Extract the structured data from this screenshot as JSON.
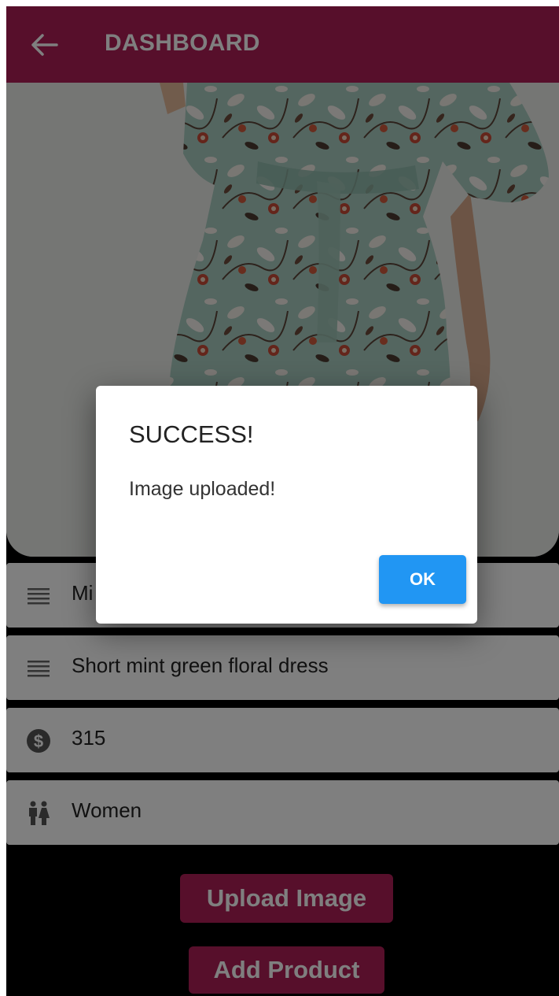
{
  "app_bar": {
    "title": "DASHBOARD",
    "back_icon": "arrow-left-icon",
    "color": "#ae1f56"
  },
  "product_image": {
    "subject": "floral-dress-photo"
  },
  "form": {
    "fields": [
      {
        "icon": "notes-icon",
        "value": "Mi"
      },
      {
        "icon": "notes-icon",
        "value": "Short mint green floral dress"
      },
      {
        "icon": "dollar-icon",
        "value": "315"
      },
      {
        "icon": "people-icon",
        "value": "Women"
      }
    ]
  },
  "buttons": {
    "upload_label": "Upload Image",
    "add_label": "Add Product"
  },
  "dialog": {
    "title": "SUCCESS!",
    "message": "Image uploaded!",
    "ok_label": "OK",
    "ok_color": "#2196f3"
  }
}
